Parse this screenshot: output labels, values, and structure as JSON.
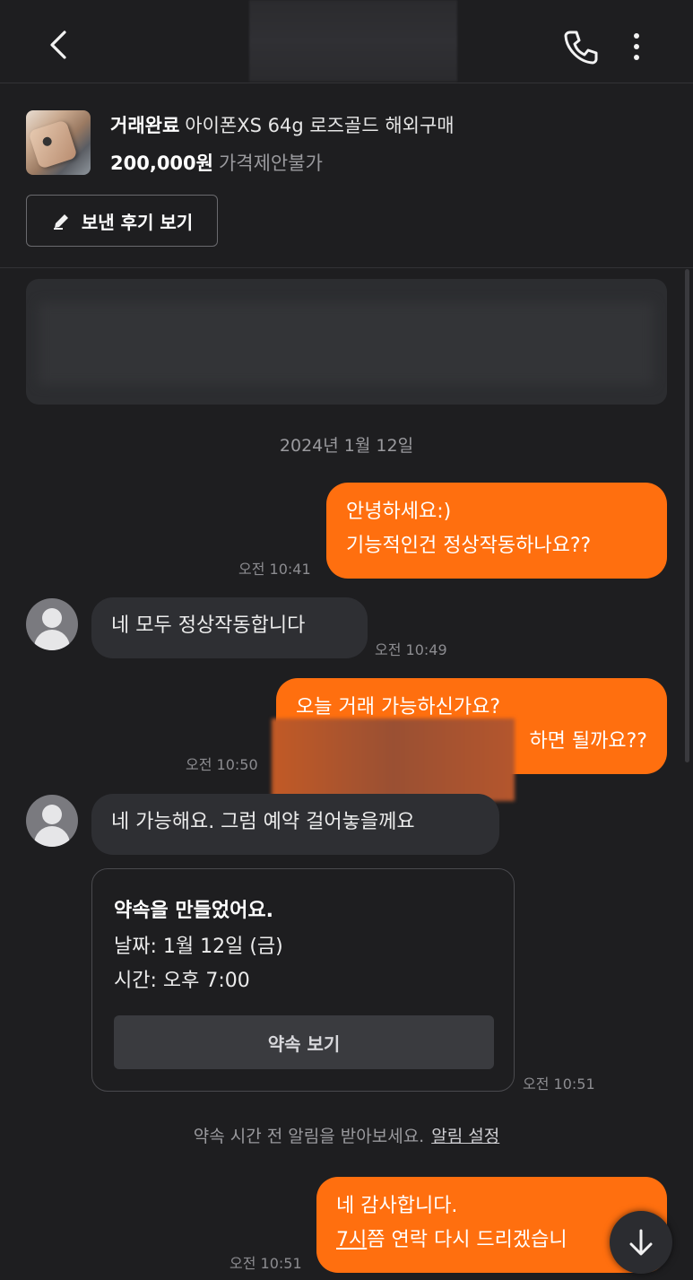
{
  "product": {
    "status": "거래완료",
    "name": "아이폰XS 64g 로즈골드 해외구매",
    "price": "200,000원",
    "price_note": "가격제안불가",
    "review_button": "보낸 후기 보기"
  },
  "date_separator": "2024년 1월 12일",
  "messages": [
    {
      "lines": [
        "안녕하세요:)",
        "기능적인건 정상작동하나요??"
      ],
      "time": "오전 10:41"
    },
    {
      "text": "네 모두 정상작동합니다",
      "time": "오전 10:49"
    },
    {
      "lines": [
        "오늘 거래 가능하신가요?",
        "하면 될까요??"
      ],
      "time": "오전 10:50"
    },
    {
      "text": "네 가능해요. 그럼 예약 걸어놓을께요"
    },
    {
      "lines": [
        "네 감사합니다.",
        "7시",
        "쯤 연락 다시 드리겠습니"
      ],
      "time": "오전 10:51"
    }
  ],
  "appointment": {
    "title": "약속을 만들었어요.",
    "date": "날짜: 1월 12일 (금)",
    "time": "시간: 오후 7:00",
    "button": "약속 보기",
    "sent_time": "오전 10:51"
  },
  "reminder": {
    "text": "약속 시간 전 알림을 받아보세요.",
    "link": "알림 설정"
  },
  "colors": {
    "outgoing_bubble": "#ff6f0f",
    "incoming_bubble": "#2e2f33",
    "background": "#1e1e20"
  }
}
